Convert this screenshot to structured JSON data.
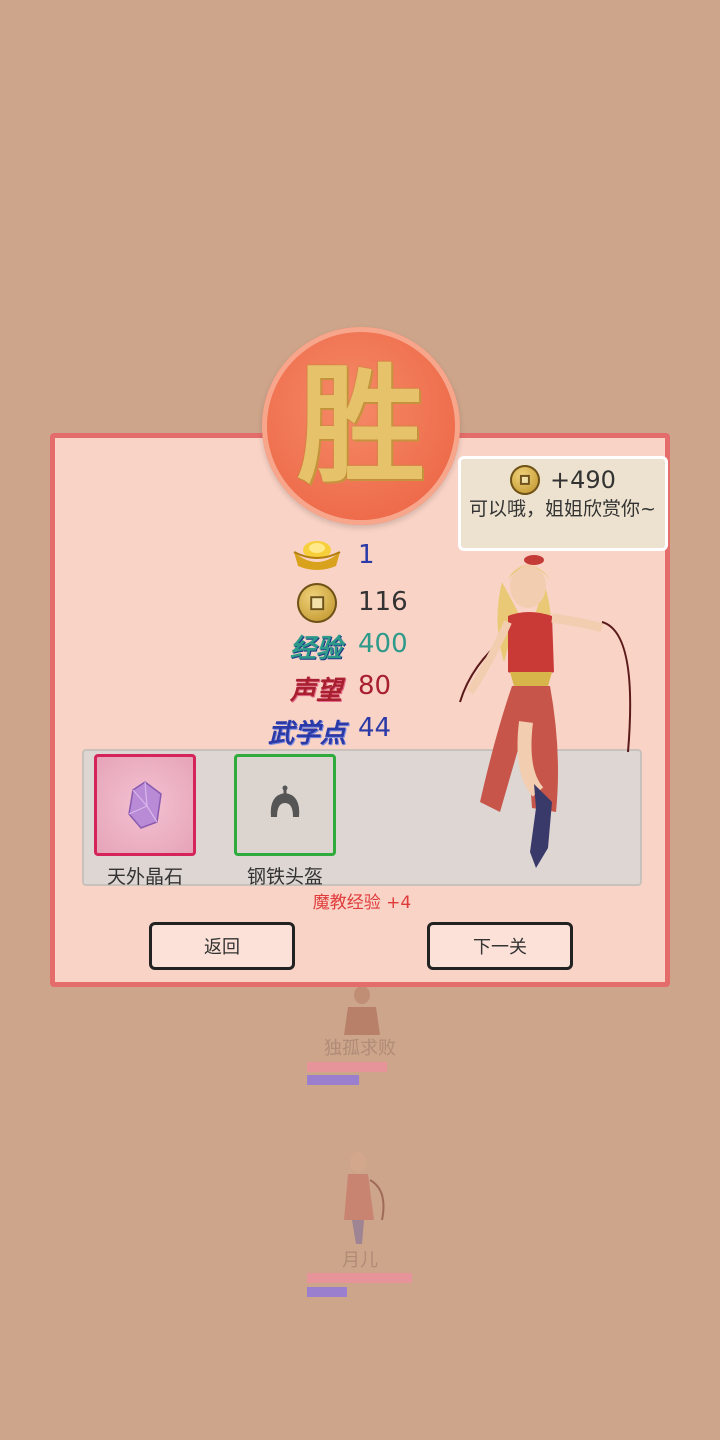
{
  "background_units": [
    {
      "name": "独孤求败",
      "hp_fraction": 0.8,
      "mp_fraction": 0.52
    },
    {
      "name": "月儿",
      "hp_fraction": 1.0,
      "mp_fraction": 0.38
    }
  ],
  "result": {
    "badge_text": "胜"
  },
  "speech": {
    "amount": "+490",
    "message": "可以哦，姐姐欣赏你~"
  },
  "rewards": {
    "gold_ingot": "1",
    "coins": "116",
    "experience_label": "经验",
    "experience_value": "400",
    "reputation_label": "声望",
    "reputation_value": "80",
    "martial_label": "武学点",
    "martial_value": "44"
  },
  "loot": [
    {
      "name": "天外晶石",
      "icon": "crystal-icon",
      "frame_color": "#d4245a"
    },
    {
      "name": "钢铁头盔",
      "icon": "helmet-icon",
      "frame_color": "#2faa3c"
    }
  ],
  "sect_experience": "魔教经验 +4",
  "buttons": {
    "back": "返回",
    "next": "下一关"
  },
  "colors": {
    "background": "#cda58b",
    "panel": "#f9d3c6",
    "panel_border": "#e46c6a",
    "badge": "#ee6c4b",
    "experience": "#2e9a8a",
    "reputation": "#a8202f",
    "martial": "#2c3aa8",
    "gold_value": "#2c3aa8"
  }
}
